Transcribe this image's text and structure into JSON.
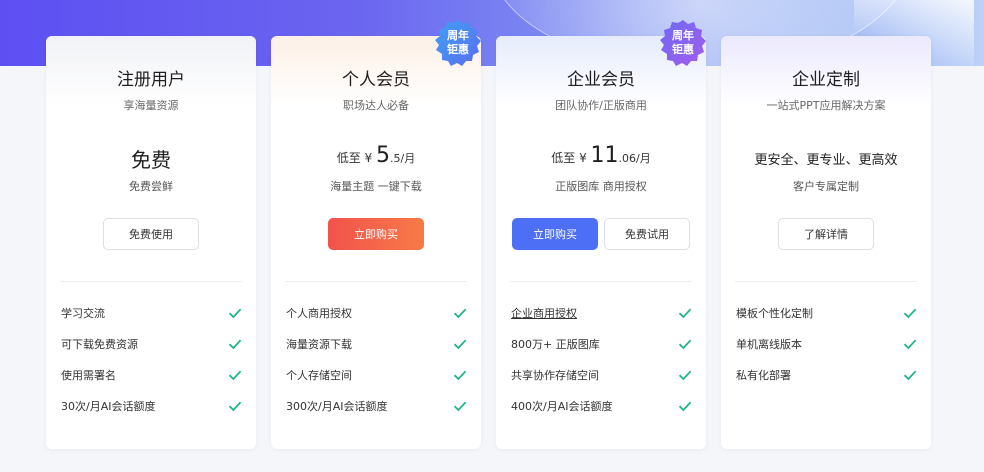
{
  "cards": [
    {
      "title": "注册用户",
      "subtitle": "享海量资源",
      "price_text": "免费",
      "note": "免费尝鲜",
      "button": "免费使用",
      "features": [
        "学习交流",
        "可下载免费资源",
        "使用需署名",
        "30次/月AI会话额度"
      ]
    },
    {
      "title": "个人会员",
      "subtitle": "职场达人必备",
      "price_prefix": "低至",
      "price_currency": "¥",
      "price_int": "5",
      "price_frac": ".5/月",
      "note": "海量主题 一键下载",
      "button": "立即购买",
      "badge": [
        "周年",
        "钜惠"
      ],
      "features": [
        "个人商用授权",
        "海量资源下载",
        "个人存储空间",
        "300次/月AI会话额度"
      ]
    },
    {
      "title": "企业会员",
      "subtitle": "团队协作/正版商用",
      "price_prefix": "低至",
      "price_currency": "¥",
      "price_int": "11",
      "price_frac": ".06/月",
      "note": "正版图库 商用授权",
      "button_primary": "立即购买",
      "button_secondary": "免费试用",
      "badge": [
        "周年",
        "钜惠"
      ],
      "features": [
        "企业商用授权",
        "800万+ 正版图库",
        "共享协作存储空间",
        "400次/月AI会话额度"
      ]
    },
    {
      "title": "企业定制",
      "subtitle": "一站式PPT应用解决方案",
      "slogan": "更安全、更专业、更高效",
      "note": "客户专属定制",
      "button": "了解详情",
      "features": [
        "模板个性化定制",
        "单机离线版本",
        "私有化部署"
      ]
    }
  ],
  "icons": {
    "check": "check-icon",
    "badge": "badge-seal-icon"
  },
  "colors": {
    "check": "#1fb48a",
    "buy_orange": "#f2524b",
    "buy_blue": "#4c6ff5",
    "badge_blue": "#4b7bef",
    "badge_purple": "#8a5ef0"
  }
}
